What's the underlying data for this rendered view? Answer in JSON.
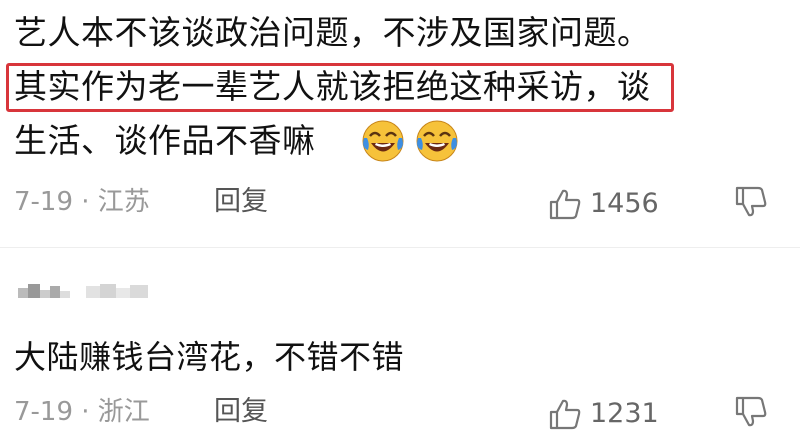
{
  "comment1": {
    "line1": "艺人本不该谈政治问题，不涉及国家问题。",
    "line2": "其实作为老一辈艺人就该拒绝这种采访，谈",
    "line3": "生活、谈作品不香嘛",
    "emojis": [
      "laughing-crying-emoji",
      "laughing-crying-emoji"
    ],
    "date_location": "7-19 · 江苏",
    "reply_label": "回复",
    "like_count": "1456"
  },
  "comment2": {
    "text": "大陆赚钱台湾花，不错不错",
    "date_location": "7-19 · 浙江",
    "reply_label": "回复",
    "like_count": "1231"
  },
  "colors": {
    "highlight_border": "#d8353b",
    "meta_text": "#999999",
    "emoji_yellow": "#f6c23a",
    "tear_blue": "#3d8fe3"
  }
}
